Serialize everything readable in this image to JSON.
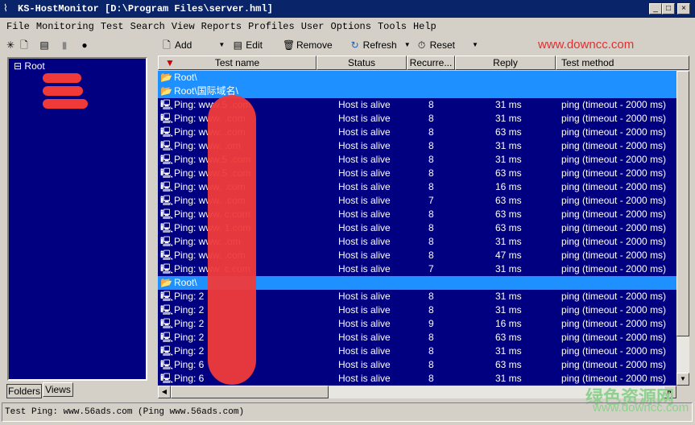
{
  "window": {
    "title": "KS-HostMonitor  [D:\\Program Files\\server.hml]",
    "minimize": "_",
    "maximize": "□",
    "close": "×"
  },
  "menu": [
    "File",
    "Monitoring",
    "Test",
    "Search",
    "View",
    "Reports",
    "Profiles",
    "User",
    "Options",
    "Tools",
    "Help"
  ],
  "toolbar": {
    "add": "Add",
    "edit": "Edit",
    "remove": "Remove",
    "refresh": "Refresh",
    "reset": "Reset"
  },
  "tree": {
    "root": "Root"
  },
  "left_tabs": [
    "Folders",
    "Views"
  ],
  "columns": [
    "Test name",
    "Status",
    "Recurre...",
    "Reply",
    "Test method"
  ],
  "rows": [
    {
      "type": "folder",
      "name": "Root\\"
    },
    {
      "type": "folder",
      "name": "Root\\国际域名\\"
    },
    {
      "type": "test",
      "name": "Ping: www.5      .com",
      "status": "Host is alive",
      "recur": "8",
      "reply": "31 ms",
      "method": "ping (timeout - 2000 ms)"
    },
    {
      "type": "test",
      "name": "Ping: www.          .com",
      "status": "Host is alive",
      "recur": "8",
      "reply": "31 ms",
      "method": "ping (timeout - 2000 ms)"
    },
    {
      "type": "test",
      "name": "Ping: www.       .com",
      "status": "Host is alive",
      "recur": "8",
      "reply": "63 ms",
      "method": "ping (timeout - 2000 ms)"
    },
    {
      "type": "test",
      "name": "Ping: www.      .om",
      "status": "Host is alive",
      "recur": "8",
      "reply": "31 ms",
      "method": "ping (timeout - 2000 ms)"
    },
    {
      "type": "test",
      "name": "Ping: www.5     .com",
      "status": "Host is alive",
      "recur": "8",
      "reply": "31 ms",
      "method": "ping (timeout - 2000 ms)"
    },
    {
      "type": "test",
      "name": "Ping: www.5     .com",
      "status": "Host is alive",
      "recur": "8",
      "reply": "63 ms",
      "method": "ping (timeout - 2000 ms)"
    },
    {
      "type": "test",
      "name": "Ping: www.       .com",
      "status": "Host is alive",
      "recur": "8",
      "reply": "16 ms",
      "method": "ping (timeout - 2000 ms)"
    },
    {
      "type": "test",
      "name": "Ping: www.       .com",
      "status": "Host is alive",
      "recur": "7",
      "reply": "63 ms",
      "method": "ping (timeout - 2000 ms)"
    },
    {
      "type": "test",
      "name": "Ping: www.      c.com",
      "status": "Host is alive",
      "recur": "8",
      "reply": "63 ms",
      "method": "ping (timeout - 2000 ms)"
    },
    {
      "type": "test",
      "name": "Ping: www.      1.com",
      "status": "Host is alive",
      "recur": "8",
      "reply": "63 ms",
      "method": "ping (timeout - 2000 ms)"
    },
    {
      "type": "test",
      "name": "Ping: www.      .om",
      "status": "Host is alive",
      "recur": "8",
      "reply": "31 ms",
      "method": "ping (timeout - 2000 ms)"
    },
    {
      "type": "test",
      "name": "Ping: www.      .com",
      "status": "Host is alive",
      "recur": "8",
      "reply": "47 ms",
      "method": "ping (timeout - 2000 ms)"
    },
    {
      "type": "test",
      "name": "Ping: www.       c.com",
      "status": "Host is alive",
      "recur": "7",
      "reply": "31 ms",
      "method": "ping (timeout - 2000 ms)"
    },
    {
      "type": "folder",
      "name": "Root\\"
    },
    {
      "type": "test",
      "name": "Ping: 2",
      "status": "Host is alive",
      "recur": "8",
      "reply": "31 ms",
      "method": "ping (timeout - 2000 ms)"
    },
    {
      "type": "test",
      "name": "Ping: 2",
      "status": "Host is alive",
      "recur": "8",
      "reply": "31 ms",
      "method": "ping (timeout - 2000 ms)"
    },
    {
      "type": "test",
      "name": "Ping: 2",
      "status": "Host is alive",
      "recur": "9",
      "reply": "16 ms",
      "method": "ping (timeout - 2000 ms)"
    },
    {
      "type": "test",
      "name": "Ping: 2",
      "status": "Host is alive",
      "recur": "8",
      "reply": "63 ms",
      "method": "ping (timeout - 2000 ms)"
    },
    {
      "type": "test",
      "name": "Ping: 2",
      "status": "Host is alive",
      "recur": "8",
      "reply": "31 ms",
      "method": "ping (timeout - 2000 ms)"
    },
    {
      "type": "test",
      "name": "Ping: 6",
      "status": "Host is alive",
      "recur": "8",
      "reply": "63 ms",
      "method": "ping (timeout - 2000 ms)"
    },
    {
      "type": "test",
      "name": "Ping: 6",
      "status": "Host is alive",
      "recur": "8",
      "reply": "31 ms",
      "method": "ping (timeout - 2000 ms)"
    }
  ],
  "status_bar": "Test Ping: www.56ads.com (Ping www.56ads.com)",
  "watermark": {
    "top": "www.downcc.com",
    "cn": "绿色资源网",
    "bottom": "www.downcc.com"
  },
  "colors": {
    "list_bg": "#000080",
    "selection": "#1e90ff",
    "title_bar": "#0a246a",
    "watermark": "#e03030",
    "watermark_green": "#8fd08f"
  }
}
